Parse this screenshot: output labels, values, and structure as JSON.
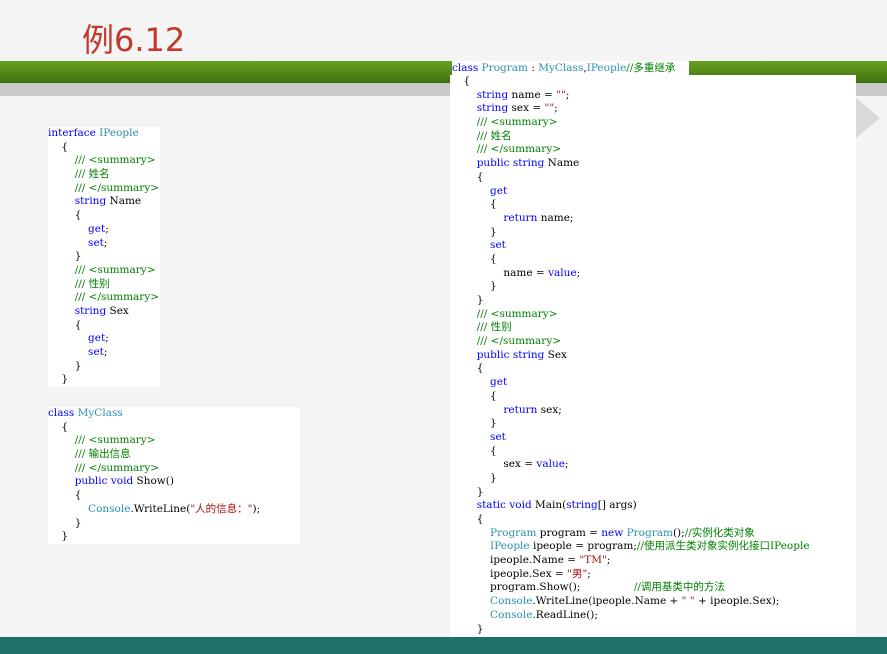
{
  "slide": {
    "title": "例6.12"
  },
  "left_code": [
    [
      [
        "kw",
        "interface "
      ],
      [
        "ty",
        "IPeople"
      ]
    ],
    [
      [
        "",
        "    {"
      ]
    ],
    [
      [
        "cm",
        "        /// <summary>"
      ]
    ],
    [
      [
        "cm",
        "        /// 姓名"
      ]
    ],
    [
      [
        "cm",
        "        /// </summary>"
      ]
    ],
    [
      [
        "kw",
        "        string"
      ],
      [
        "",
        " Name"
      ]
    ],
    [
      [
        "",
        "        {"
      ]
    ],
    [
      [
        "kw",
        "            get"
      ],
      [
        "",
        ";"
      ]
    ],
    [
      [
        "kw",
        "            set"
      ],
      [
        "",
        ";"
      ]
    ],
    [
      [
        "",
        "        }"
      ]
    ],
    [
      [
        "cm",
        "        /// <summary>"
      ]
    ],
    [
      [
        "cm",
        "        /// 性别"
      ]
    ],
    [
      [
        "cm",
        "        /// </summary>"
      ]
    ],
    [
      [
        "kw",
        "        string"
      ],
      [
        "",
        " Sex"
      ]
    ],
    [
      [
        "",
        "        {"
      ]
    ],
    [
      [
        "kw",
        "            get"
      ],
      [
        "",
        ";"
      ]
    ],
    [
      [
        "kw",
        "            set"
      ],
      [
        "",
        ";"
      ]
    ],
    [
      [
        "",
        "        }"
      ]
    ],
    [
      [
        "",
        "    }"
      ]
    ]
  ],
  "myclass_code": [
    [
      [
        "kw",
        "class "
      ],
      [
        "ty",
        "MyClass"
      ]
    ],
    [
      [
        "",
        "    {"
      ]
    ],
    [
      [
        "cm",
        "        /// <summary>"
      ]
    ],
    [
      [
        "cm",
        "        /// 输出信息"
      ]
    ],
    [
      [
        "cm",
        "        /// </summary>"
      ]
    ],
    [
      [
        "kw",
        "        public void"
      ],
      [
        "",
        " Show()"
      ]
    ],
    [
      [
        "",
        "        {"
      ]
    ],
    [
      [
        "ty",
        "            Console"
      ],
      [
        "",
        ".WriteLine("
      ],
      [
        "st",
        "\"人的信息：\""
      ],
      [
        "",
        ");"
      ]
    ],
    [
      [
        "",
        "        }"
      ]
    ],
    [
      [
        "",
        "    }"
      ]
    ]
  ],
  "program_header": [
    [
      "kw",
      "class "
    ],
    [
      "ty",
      "Program"
    ],
    [
      "",
      " : "
    ],
    [
      "ty",
      "MyClass"
    ],
    [
      "",
      ","
    ],
    [
      "ty",
      "IPeople"
    ],
    [
      "cm",
      "//多重继承"
    ]
  ],
  "program_code": [
    [
      [
        "",
        "    {"
      ]
    ],
    [
      [
        "kw",
        "        string"
      ],
      [
        "",
        " name = "
      ],
      [
        "st",
        "\"\""
      ],
      [
        "",
        ";"
      ]
    ],
    [
      [
        "kw",
        "        string"
      ],
      [
        "",
        " sex = "
      ],
      [
        "st",
        "\"\""
      ],
      [
        "",
        ";"
      ]
    ],
    [
      [
        "cm",
        "        /// <summary>"
      ]
    ],
    [
      [
        "cm",
        "        /// 姓名"
      ]
    ],
    [
      [
        "cm",
        "        /// </summary>"
      ]
    ],
    [
      [
        "kw",
        "        public string"
      ],
      [
        "",
        " Name"
      ]
    ],
    [
      [
        "",
        "        {"
      ]
    ],
    [
      [
        "kw",
        "            get"
      ]
    ],
    [
      [
        "",
        "            {"
      ]
    ],
    [
      [
        "kw",
        "                return"
      ],
      [
        "",
        " name;"
      ]
    ],
    [
      [
        "",
        "            }"
      ]
    ],
    [
      [
        "kw",
        "            set"
      ]
    ],
    [
      [
        "",
        "            {"
      ]
    ],
    [
      [
        "",
        "                name = "
      ],
      [
        "kw",
        "value"
      ],
      [
        "",
        ";"
      ]
    ],
    [
      [
        "",
        "            }"
      ]
    ],
    [
      [
        "",
        "        }"
      ]
    ],
    [
      [
        "cm",
        "        /// <summary>"
      ]
    ],
    [
      [
        "cm",
        "        /// 性别"
      ]
    ],
    [
      [
        "cm",
        "        /// </summary>"
      ]
    ],
    [
      [
        "kw",
        "        public string"
      ],
      [
        "",
        " Sex"
      ]
    ],
    [
      [
        "",
        "        {"
      ]
    ],
    [
      [
        "kw",
        "            get"
      ]
    ],
    [
      [
        "",
        "            {"
      ]
    ],
    [
      [
        "kw",
        "                return"
      ],
      [
        "",
        " sex;"
      ]
    ],
    [
      [
        "",
        "            }"
      ]
    ],
    [
      [
        "kw",
        "            set"
      ]
    ],
    [
      [
        "",
        "            {"
      ]
    ],
    [
      [
        "",
        "                sex = "
      ],
      [
        "kw",
        "value"
      ],
      [
        "",
        ";"
      ]
    ],
    [
      [
        "",
        "            }"
      ]
    ],
    [
      [
        "",
        "        }"
      ]
    ],
    [
      [
        "kw",
        "        static void"
      ],
      [
        "",
        " Main("
      ],
      [
        "kw",
        "string"
      ],
      [
        "",
        "[] args)"
      ]
    ],
    [
      [
        "",
        "        {"
      ]
    ],
    [
      [
        "ty",
        "            Program"
      ],
      [
        "",
        " program = "
      ],
      [
        "kw",
        "new "
      ],
      [
        "ty",
        "Program"
      ],
      [
        "",
        "();"
      ],
      [
        "cm",
        "//实例化类对象"
      ]
    ],
    [
      [
        "ty",
        "            IPeople"
      ],
      [
        "",
        " ipeople = program;"
      ],
      [
        "cm",
        "//使用派生类对象实例化接口IPeople"
      ]
    ],
    [
      [
        "",
        "            ipeople.Name = "
      ],
      [
        "st",
        "\"TM\""
      ],
      [
        "",
        ";"
      ]
    ],
    [
      [
        "",
        "            ipeople.Sex = "
      ],
      [
        "st",
        "\"男\""
      ],
      [
        "",
        ";"
      ]
    ],
    [
      [
        "",
        "            program.Show();                "
      ],
      [
        "cm",
        "//调用基类中的方法"
      ]
    ],
    [
      [
        "ty",
        "            Console"
      ],
      [
        "",
        ".WriteLine(ipeople.Name + "
      ],
      [
        "st",
        "\" \""
      ],
      [
        "",
        " + ipeople.Sex);"
      ]
    ],
    [
      [
        "ty",
        "            Console"
      ],
      [
        "",
        ".ReadLine();"
      ]
    ],
    [
      [
        "",
        "        }"
      ]
    ],
    [
      [
        "",
        "    }"
      ]
    ]
  ]
}
